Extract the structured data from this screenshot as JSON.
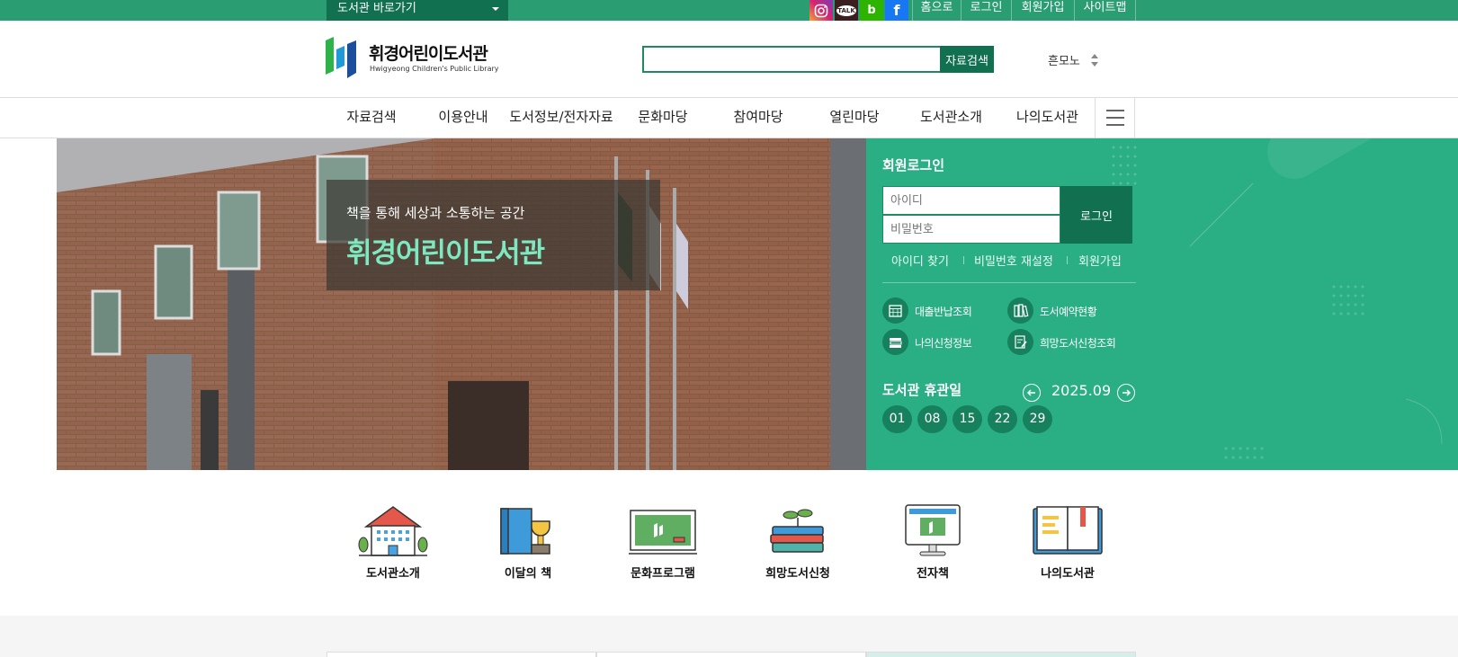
{
  "topbar": {
    "library_shortcut": "도서관 바로가기",
    "sns": {
      "kakao": "TALK",
      "blog": "b",
      "facebook": "f"
    },
    "util": {
      "home": "홈으로",
      "login": "로그인",
      "join": "회원가입",
      "sitemap": "사이트맵"
    }
  },
  "header": {
    "logo_title": "휘경어린이도서관",
    "logo_subtitle": "Hwigyeong Children's Public Library",
    "search_value": "",
    "search_button": "자료검색",
    "font_toggle": "흔모노"
  },
  "gnb": {
    "items": [
      "자료검색",
      "이용안내",
      "도서정보/전자자료",
      "문화마당",
      "참여마당",
      "열린마당",
      "도서관소개",
      "나의도서관"
    ]
  },
  "hero": {
    "subtitle": "책을 통해 세상과 소통하는 공간",
    "title": "휘경어린이도서관"
  },
  "login": {
    "title": "회원로그인",
    "id_placeholder": "아이디",
    "pw_placeholder": "비밀번호",
    "button": "로그인",
    "links": [
      "아이디 찾기",
      "비밀번호 재설정",
      "회원가입"
    ],
    "quick": [
      "대출반납조회",
      "도서예약현황",
      "나의신청정보",
      "희망도서신청조회"
    ]
  },
  "holiday": {
    "title": "도서관 휴관일",
    "month": "2025.09",
    "days": [
      "01",
      "08",
      "15",
      "22",
      "29"
    ]
  },
  "quick_menu": [
    "도서관소개",
    "이달의 책",
    "문화프로그램",
    "희망도서신청",
    "전자책",
    "나의도서관"
  ],
  "colors": {
    "brand": "#2a9d73",
    "brand_dark": "#10704f",
    "panel": "#2aae84",
    "hero_title": "#7ee8c0"
  }
}
